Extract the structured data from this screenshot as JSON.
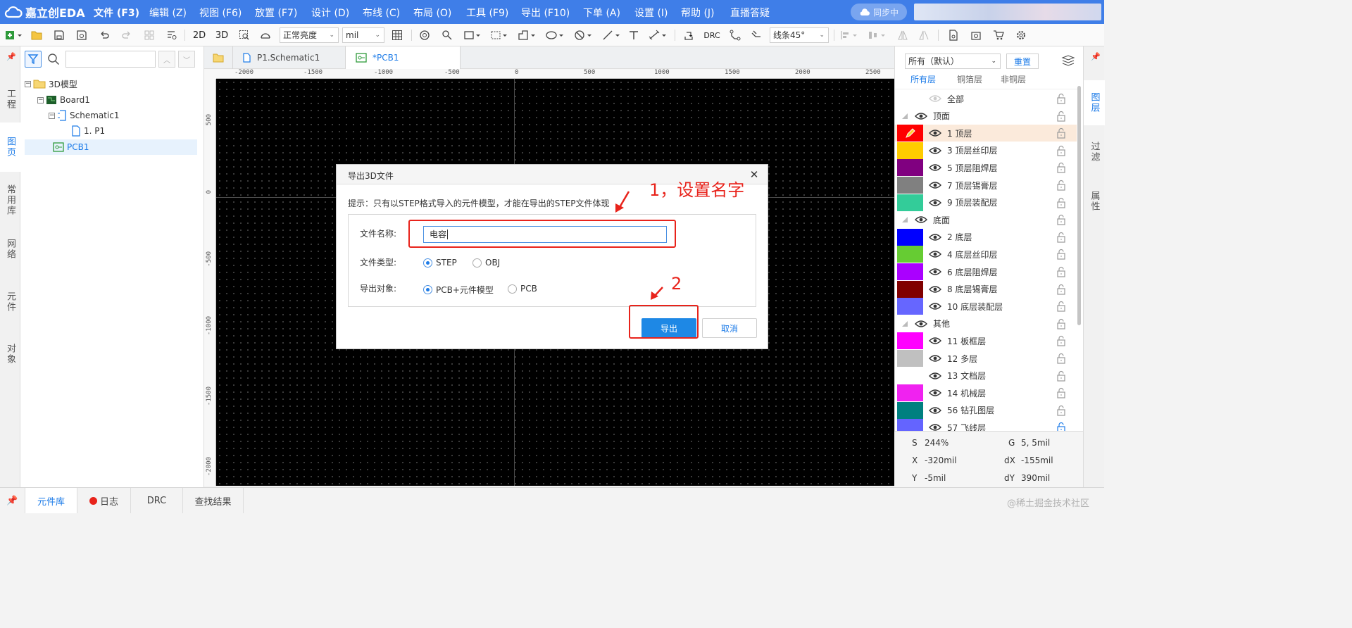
{
  "app": {
    "logo_text": "嘉立创EDA"
  },
  "menu": [
    "文件 (F3)",
    "编辑 (Z)",
    "视图 (F6)",
    "放置 (F7)",
    "设计 (D)",
    "布线 (C)",
    "布局 (O)",
    "工具 (F9)",
    "导出 (F10)",
    "下单 (A)",
    "设置 (I)",
    "帮助 (J)",
    "直播答疑"
  ],
  "sync_label": "同步中",
  "toolbar": {
    "btn_2d": "2D",
    "btn_3d": "3D",
    "brightness": "正常亮度",
    "unit": "mil",
    "drc": "DRC",
    "line_mode": "线条45°"
  },
  "left_tabs": [
    "工程",
    "图页",
    "常用库",
    "网络",
    "元件",
    "对象"
  ],
  "tree": [
    {
      "label": "3D模型",
      "icon": "folder-icon"
    },
    {
      "label": "Board1",
      "icon": "board-icon"
    },
    {
      "label": "Schematic1",
      "icon": "schematic-icon"
    },
    {
      "label": "1. P1",
      "icon": "page-icon"
    },
    {
      "label": "PCB1",
      "icon": "pcb-icon"
    }
  ],
  "doc_tabs": {
    "schematic": "P1.Schematic1",
    "pcb": "*PCB1"
  },
  "ruler": {
    "top": [
      "-2000",
      "-1500",
      "-1000",
      "-500",
      "0",
      "500",
      "1000",
      "1500",
      "2000",
      "2500"
    ],
    "left": [
      "500",
      "0",
      "-500",
      "-1000",
      "-1500",
      "-2000"
    ]
  },
  "dialog": {
    "title": "导出3D文件",
    "hint": "提示：只有以STEP格式导入的元件模型，才能在导出的STEP文件体现",
    "filename_label": "文件名称:",
    "filename_value": "电容",
    "filetype_label": "文件类型:",
    "filetype_options": [
      "STEP",
      "OBJ"
    ],
    "filetype_selected": "STEP",
    "export_label": "导出对象:",
    "export_options": [
      "PCB+元件模型",
      "PCB"
    ],
    "export_selected": "PCB+元件模型",
    "export_btn": "导出",
    "cancel_btn": "取消"
  },
  "annotations": {
    "step1": "1，设置名字",
    "step2": "2",
    "color": "#e8231b"
  },
  "layer_panel": {
    "filter_select": "所有（默认）",
    "reset_btn": "重置",
    "tabs": [
      "所有层",
      "铜箔层",
      "非铜层"
    ],
    "all_label": "全部",
    "groups": {
      "top": "顶面",
      "bottom": "底面",
      "other": "其他"
    },
    "layers": [
      {
        "name": "1 顶层",
        "color": "#ff0000"
      },
      {
        "name": "3 顶层丝印层",
        "color": "#ffcc00"
      },
      {
        "name": "5 顶层阻焊层",
        "color": "#800080"
      },
      {
        "name": "7 顶层锡膏层",
        "color": "#808080"
      },
      {
        "name": "9 顶层装配层",
        "color": "#33cc99"
      },
      {
        "name": "2 底层",
        "color": "#0000ff"
      },
      {
        "name": "4 底层丝印层",
        "color": "#66cc33"
      },
      {
        "name": "6 底层阻焊层",
        "color": "#aa00ff"
      },
      {
        "name": "8 底层锡膏层",
        "color": "#800000"
      },
      {
        "name": "10 底层装配层",
        "color": "#6666ff"
      },
      {
        "name": "11 板框层",
        "color": "#ff00ff"
      },
      {
        "name": "12 多层",
        "color": "#c0c0c0"
      },
      {
        "name": "13 文档层",
        "color": "#ffffff"
      },
      {
        "name": "14 机械层",
        "color": "#f022f0"
      },
      {
        "name": "56 钻孔图层",
        "color": "#008080"
      },
      {
        "name": "57 飞线层",
        "color": "#6464ff"
      }
    ]
  },
  "right_tabs": [
    "图层",
    "过滤",
    "属性"
  ],
  "status": {
    "s": "S",
    "s_val": "244%",
    "g": "G",
    "g_val": "5, 5mil",
    "x": "X",
    "x_val": "-320mil",
    "dx": "dX",
    "dx_val": "-155mil",
    "y": "Y",
    "y_val": "-5mil",
    "dy": "dY",
    "dy_val": "390mil"
  },
  "bottom_tabs": [
    "元件库",
    "日志",
    "DRC",
    "查找结果"
  ],
  "watermark": "@稀土掘金技术社区"
}
